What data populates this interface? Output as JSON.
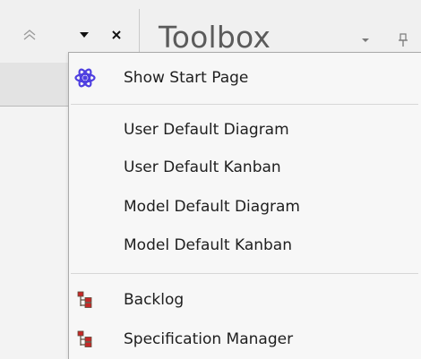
{
  "title_bar": {
    "title": "Toolbox"
  },
  "menu": {
    "start_page_label": "Show Start Page",
    "diagram_items": [
      "User Default Diagram",
      "User Default Kanban",
      "Model Default Diagram",
      "Model Default Kanban"
    ],
    "bottom_items": [
      "Backlog",
      "Specification Manager"
    ]
  },
  "colors": {
    "start_icon": "#4f3fe0",
    "tree_icon_red": "#c62828",
    "tree_icon_dark": "#5a4a3a",
    "menu_background": "#f7f7f7"
  }
}
